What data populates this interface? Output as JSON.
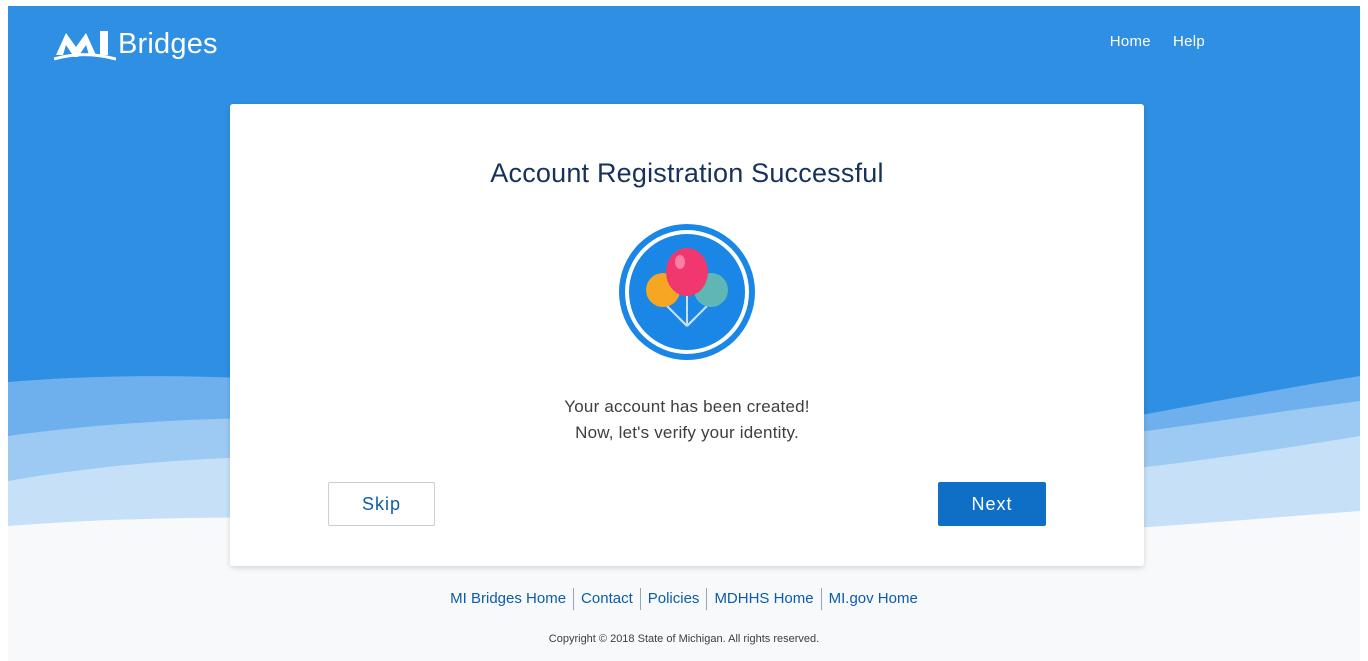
{
  "header": {
    "logo_text": "Bridges",
    "logo_mark_text": "MI",
    "nav": [
      {
        "label": "Home"
      },
      {
        "label": "Help"
      }
    ]
  },
  "card": {
    "title": "Account Registration Successful",
    "icon": "balloons-icon",
    "message_line1": "Your account has been created!",
    "message_line2": "Now, let's verify your identity.",
    "skip_label": "Skip",
    "next_label": "Next"
  },
  "footer": {
    "links": [
      {
        "label": "MI Bridges Home"
      },
      {
        "label": "Contact"
      },
      {
        "label": "Policies"
      },
      {
        "label": "MDHHS Home"
      },
      {
        "label": "MI.gov Home"
      }
    ],
    "copyright": "Copyright © 2018 State of Michigan. All rights reserved."
  },
  "colors": {
    "brand_blue": "#2e8fe3",
    "primary_button": "#0f6fc6",
    "title_navy": "#16325c",
    "link_blue": "#0b5cab"
  }
}
